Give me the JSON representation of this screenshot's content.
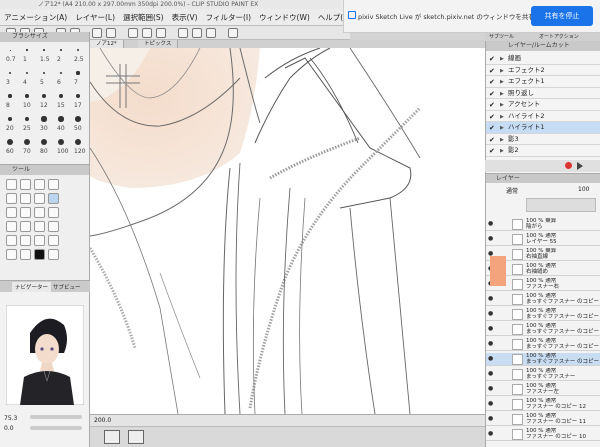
{
  "window": {
    "title": "ノア12* (A4 210.00 x 297.00mm 350dpi 200.0%) - CLIP STUDIO PAINT EX"
  },
  "menu": [
    "アニメーション(A)",
    "レイヤー(L)",
    "選択範囲(S)",
    "表示(V)",
    "フィルター(I)",
    "ウィンドウ(W)",
    "ヘルプ(H)"
  ],
  "share_bar": {
    "message": "pixiv Sketch Live が sketch.pixiv.net のウィンドウを共有しています。",
    "stop_button": "共有を停止"
  },
  "brush_panel": {
    "title": "ブラシサイズ",
    "sizes": [
      "0.7",
      "1",
      "1.5",
      "2",
      "2.5",
      "3",
      "4",
      "5",
      "6",
      "7",
      "8",
      "10",
      "12",
      "15",
      "17",
      "20",
      "25",
      "30",
      "40",
      "50",
      "60",
      "70",
      "80",
      "100",
      "120"
    ]
  },
  "tool_panel": {
    "title": "ツール"
  },
  "navigator": {
    "tab_navigator": "ナビゲーター",
    "tab_subview": "サブビュー",
    "zoom": "75.3",
    "rotation": "0.0"
  },
  "canvas": {
    "tabs": [
      "ノア12*",
      "トピックス"
    ],
    "status_zoom": "200.0"
  },
  "right_tabs": [
    "サブツール",
    "オートアクション",
    "レイヤー"
  ],
  "folder_panel": {
    "title": "レイヤー/ルームカット",
    "rows": [
      {
        "label": "線画",
        "selected": false
      },
      {
        "label": "エフェクト2",
        "selected": false
      },
      {
        "label": "エフェクト1",
        "selected": false
      },
      {
        "label": "照り返し",
        "selected": false
      },
      {
        "label": "アクセント",
        "selected": false
      },
      {
        "label": "ハイライト2",
        "selected": false
      },
      {
        "label": "ハイライト1",
        "selected": true
      },
      {
        "label": "影3",
        "selected": false
      },
      {
        "label": "影2",
        "selected": false
      }
    ]
  },
  "layer_panel": {
    "title": "レイヤー",
    "blend_mode": "通常",
    "opacity": "100",
    "layers": [
      {
        "line1": "100 % 乗算",
        "line2": "陰がら",
        "selected": false
      },
      {
        "line1": "100 % 通常",
        "line2": "レイヤー 55",
        "selected": false
      },
      {
        "line1": "100 % 乗算",
        "line2": "右袖直線",
        "selected": false
      },
      {
        "line1": "100 % 通常",
        "line2": "右袖縫め",
        "selected": false
      },
      {
        "line1": "100 % 通常",
        "line2": "ファスナー右",
        "selected": false
      },
      {
        "line1": "100 % 通常",
        "line2": "まっすぐファスナー のコピー 7",
        "selected": false
      },
      {
        "line1": "100 % 通常",
        "line2": "まっすぐファスナー のコピー 6",
        "selected": false
      },
      {
        "line1": "100 % 通常",
        "line2": "まっすぐファスナー のコピー 5",
        "selected": false
      },
      {
        "line1": "100 % 通常",
        "line2": "まっすぐファスナー のコピー 8",
        "selected": false
      },
      {
        "line1": "100 % 通常",
        "line2": "まっすぐファスナー のコピー 9",
        "selected": true
      },
      {
        "line1": "100 % 通常",
        "line2": "まっすぐファスナー",
        "selected": false
      },
      {
        "line1": "100 % 通常",
        "line2": "ファスナー左",
        "selected": false
      },
      {
        "line1": "100 % 通常",
        "line2": "ファスナー のコピー 12",
        "selected": false
      },
      {
        "line1": "100 % 通常",
        "line2": "ファスナー のコピー 11",
        "selected": false
      },
      {
        "line1": "100 % 通常",
        "line2": "ファスナー のコピー 10",
        "selected": false
      }
    ]
  },
  "colors": {
    "accent": "#1a73e8",
    "selection": "#c5dcf4",
    "skin": "#f2d9c4",
    "swatch_orange": "#f4a47c"
  }
}
